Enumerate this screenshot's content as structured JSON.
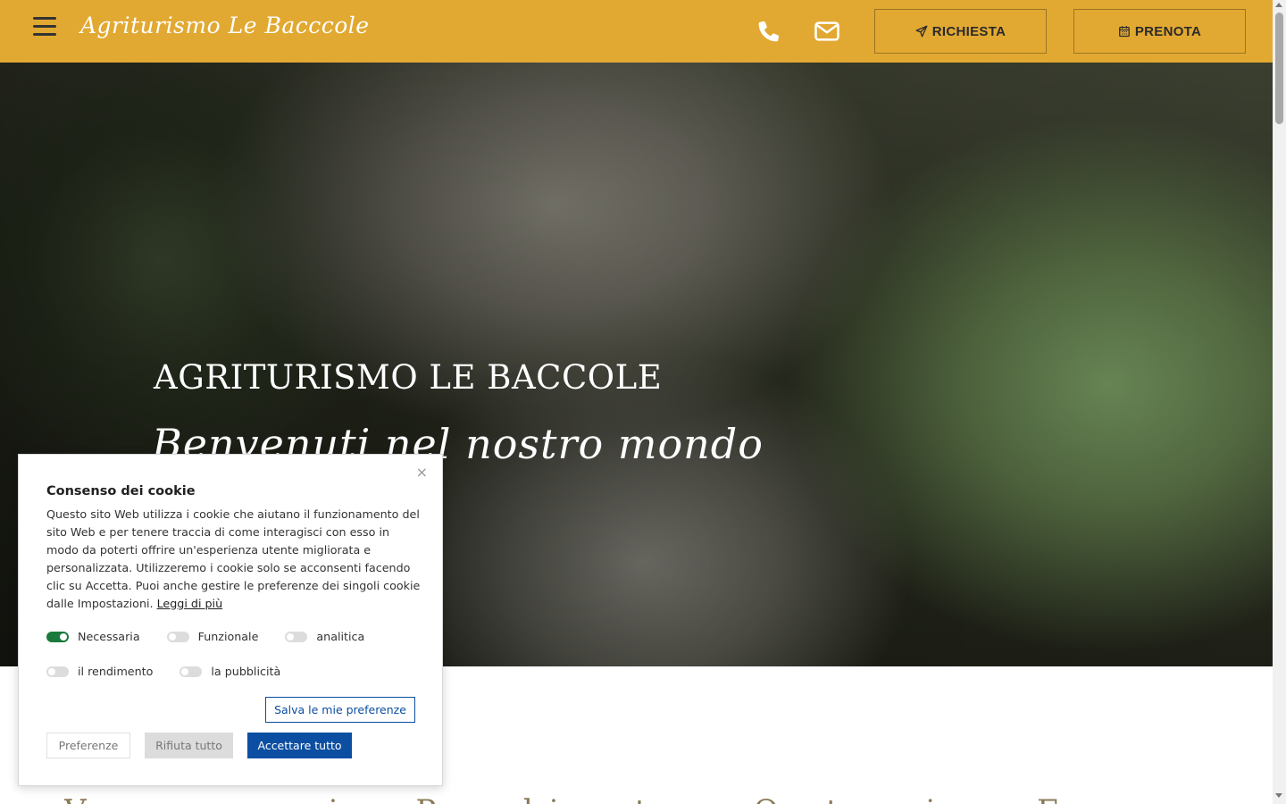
{
  "header": {
    "logo": "Agriturismo Le Bacccole",
    "richiesta_label": "RICHIESTA",
    "prenota_label": "PRENOTA",
    "bg_color": "#e2a932"
  },
  "hero": {
    "title": "AGRITURISMO LE BACCOLE",
    "subtitle": "Benvenuti nel nostro mondo"
  },
  "next_section": {
    "heading": "Vacanze in Puglia tra Ostuni e Fasano"
  },
  "cookie": {
    "title": "Consenso dei cookie",
    "text": "Questo sito Web utilizza i cookie che aiutano il funzionamento del sito Web e per tenere traccia di come interagisci con esso in modo da poterti offrire un'esperienza utente migliorata e personalizzata. Utilizzeremo i cookie solo se acconsenti facendo clic su Accetta. Puoi anche gestire le preferenze dei singoli cookie dalle Impostazioni.",
    "read_more": "Leggi di più",
    "close": "×",
    "toggles": {
      "necessary": "Necessaria",
      "functional": "Funzionale",
      "analytics": "analitica",
      "performance": "il rendimento",
      "advertising": "la pubblicità"
    },
    "save_label": "Salva le mie preferenze",
    "preferences_label": "Preferenze",
    "reject_label": "Rifiuta tutto",
    "accept_label": "Accettare tutto",
    "accent_color": "#0b4ea2",
    "on_color": "#1a7a3c"
  }
}
